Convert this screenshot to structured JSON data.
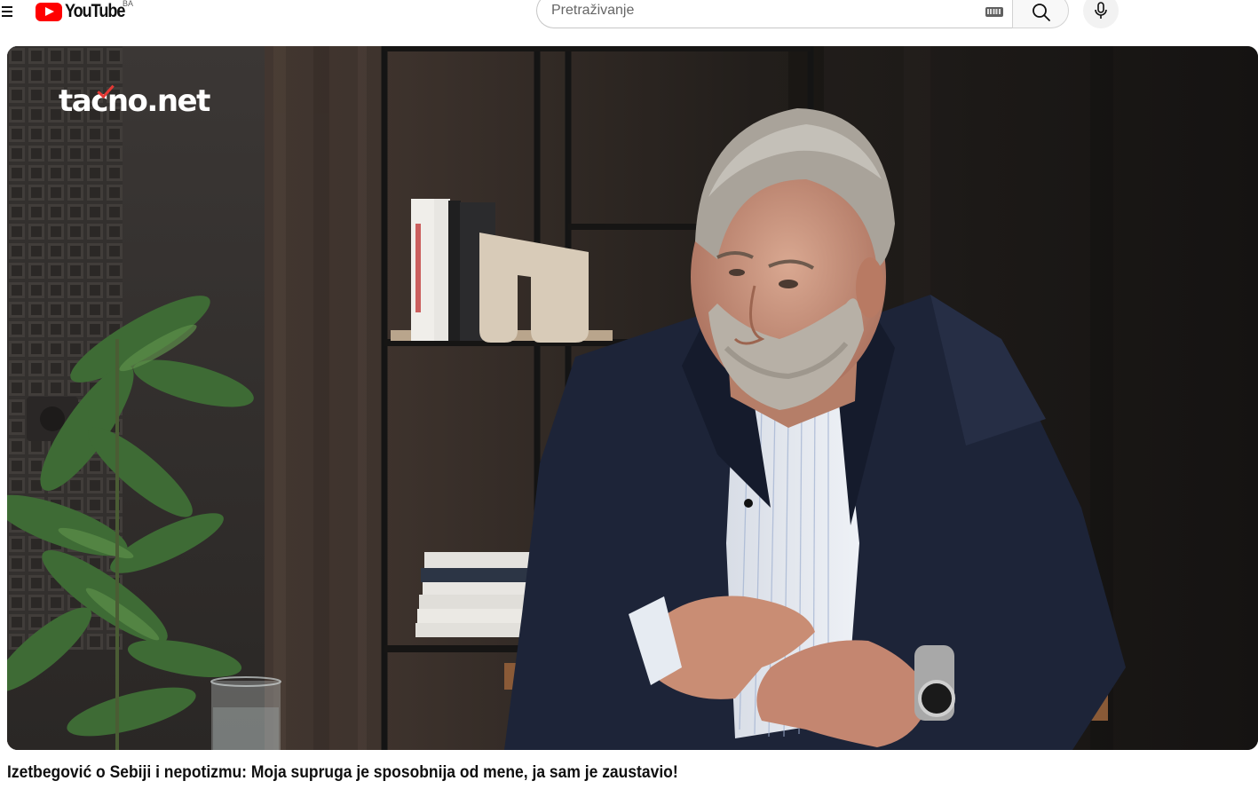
{
  "masthead": {
    "menu_icon": "hamburger-menu-icon",
    "logo_text": "YouTube",
    "country_code": "BA",
    "search": {
      "placeholder": "Pretraživanje",
      "value": ""
    },
    "keyboard_icon": "keyboard-icon",
    "search_icon": "search-icon",
    "mic_icon": "microphone-icon"
  },
  "player": {
    "watermark": "tacno.net"
  },
  "video": {
    "title": "Izetbegović o Sebiji i nepotizmu: Moja supruga je sposobnija od mene, ja sam je zaustavio!"
  },
  "colors": {
    "brand_red": "#ff0000",
    "watermark_check": "#e53935"
  }
}
